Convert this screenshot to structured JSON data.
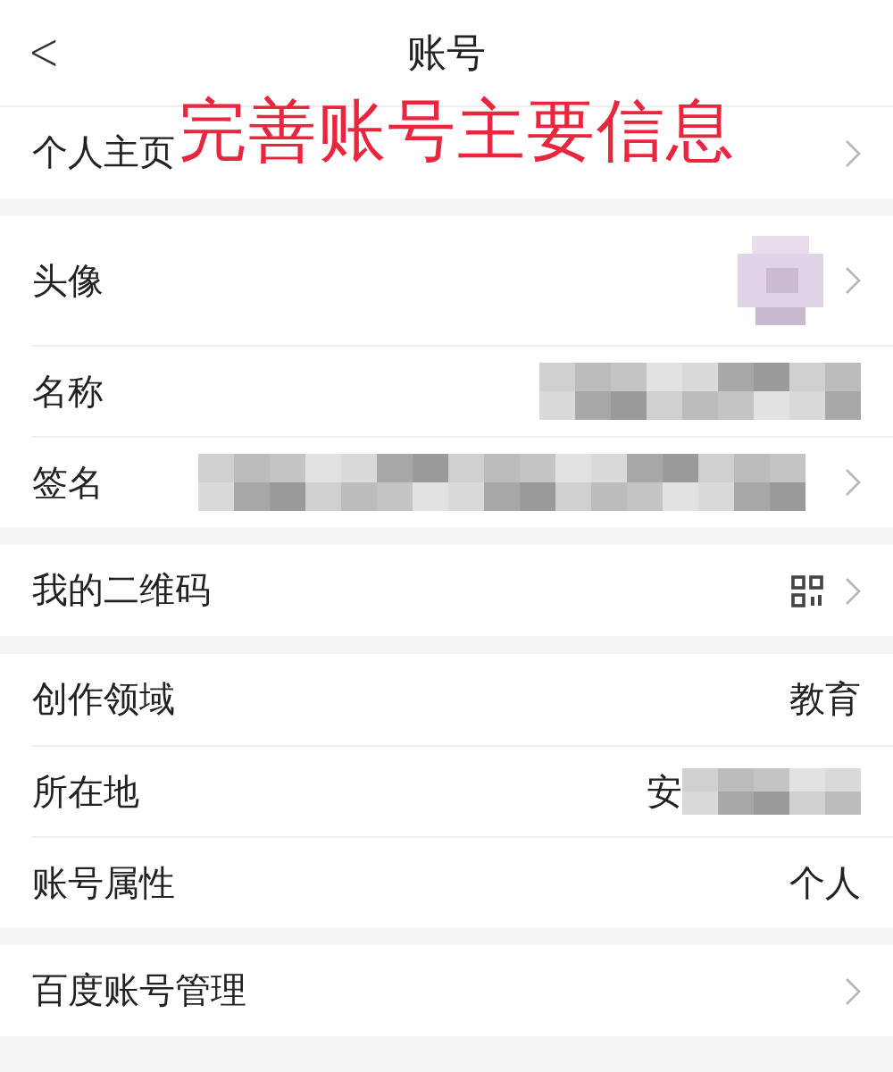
{
  "header": {
    "back": "<",
    "title": "账号"
  },
  "annotation": "完善账号主要信息",
  "groups": [
    {
      "rows": [
        {
          "label": "个人主页",
          "kind": "none",
          "chevron": true
        }
      ]
    },
    {
      "rows": [
        {
          "label": "头像",
          "kind": "avatar",
          "chevron": true
        },
        {
          "label": "名称",
          "kind": "blurred",
          "chevron": false
        },
        {
          "label": "签名",
          "kind": "blurred-long",
          "chevron": true
        }
      ]
    },
    {
      "rows": [
        {
          "label": "我的二维码",
          "kind": "qr",
          "chevron": true
        }
      ]
    },
    {
      "rows": [
        {
          "label": "创作领域",
          "kind": "text",
          "value": "教育",
          "chevron": false
        },
        {
          "label": "所在地",
          "kind": "partly-blurred",
          "value": "安",
          "chevron": false
        },
        {
          "label": "账号属性",
          "kind": "text",
          "value": "个人",
          "chevron": false
        }
      ]
    },
    {
      "rows": [
        {
          "label": "百度账号管理",
          "kind": "none",
          "chevron": true
        }
      ]
    }
  ]
}
